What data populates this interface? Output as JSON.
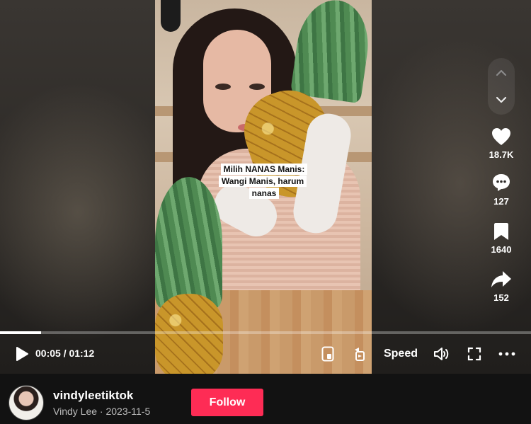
{
  "video": {
    "caption_line1": "Milih NANAS Manis:",
    "caption_line2": "Wangi Manis, harum nanas"
  },
  "navigation": {
    "up_icon": "chevron-up-icon",
    "down_icon": "chevron-down-icon"
  },
  "actions": {
    "likes": "18.7K",
    "comments": "127",
    "saves": "1640",
    "shares": "152"
  },
  "player": {
    "current_time": "00:05",
    "duration": "01:12",
    "time_display": "00:05 / 01:12",
    "progress_fraction": 0.077,
    "speed_label": "Speed"
  },
  "author": {
    "username": "vindyleetiktok",
    "display_name": "Vindy Lee",
    "date": "2023-11-5",
    "subline": "Vindy Lee · 2023-11-5",
    "follow_label": "Follow"
  },
  "colors": {
    "follow": "#fe2c55",
    "background": "#121212"
  }
}
